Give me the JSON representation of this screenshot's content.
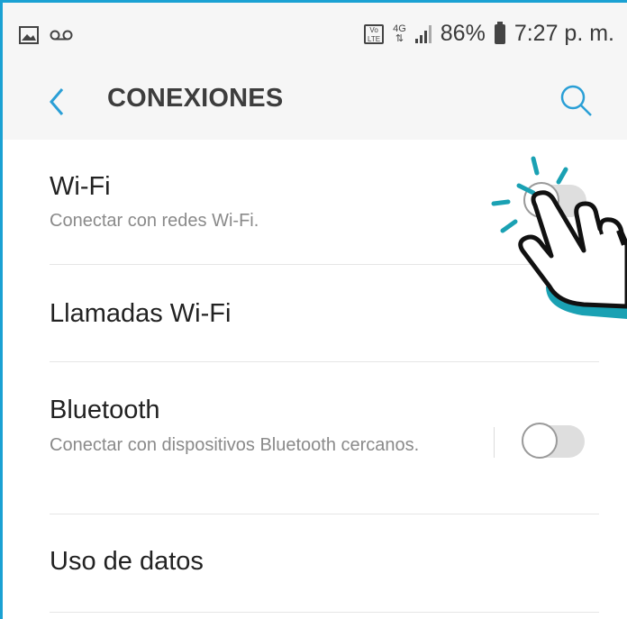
{
  "status_bar": {
    "left_icons": [
      "image-icon",
      "voicemail-icon"
    ],
    "right_icons": [
      "volte-icon",
      "4g-icon",
      "signal-icon",
      "battery-icon"
    ],
    "network_label": "4G",
    "battery_percent": "86%",
    "time": "7:27 p. m."
  },
  "header": {
    "back_icon": "chevron-left-icon",
    "title": "CONEXIONES",
    "search_icon": "search-icon"
  },
  "settings": {
    "items": [
      {
        "title": "Wi-Fi",
        "subtitle": "Conectar con redes Wi-Fi.",
        "toggle_on": false
      },
      {
        "title": "Llamadas Wi-Fi"
      },
      {
        "title": "Bluetooth",
        "subtitle": "Conectar con dispositivos Bluetooth cercanos.",
        "toggle_on": false
      },
      {
        "title": "Uso de datos"
      }
    ]
  },
  "overlay": {
    "icon": "pointing-hand-icon",
    "accent": "#1aa1b3"
  },
  "colors": {
    "border": "#1aa1d3",
    "accent": "#2a9fd6",
    "text": "#222222",
    "subtext": "#8a8a8a"
  }
}
